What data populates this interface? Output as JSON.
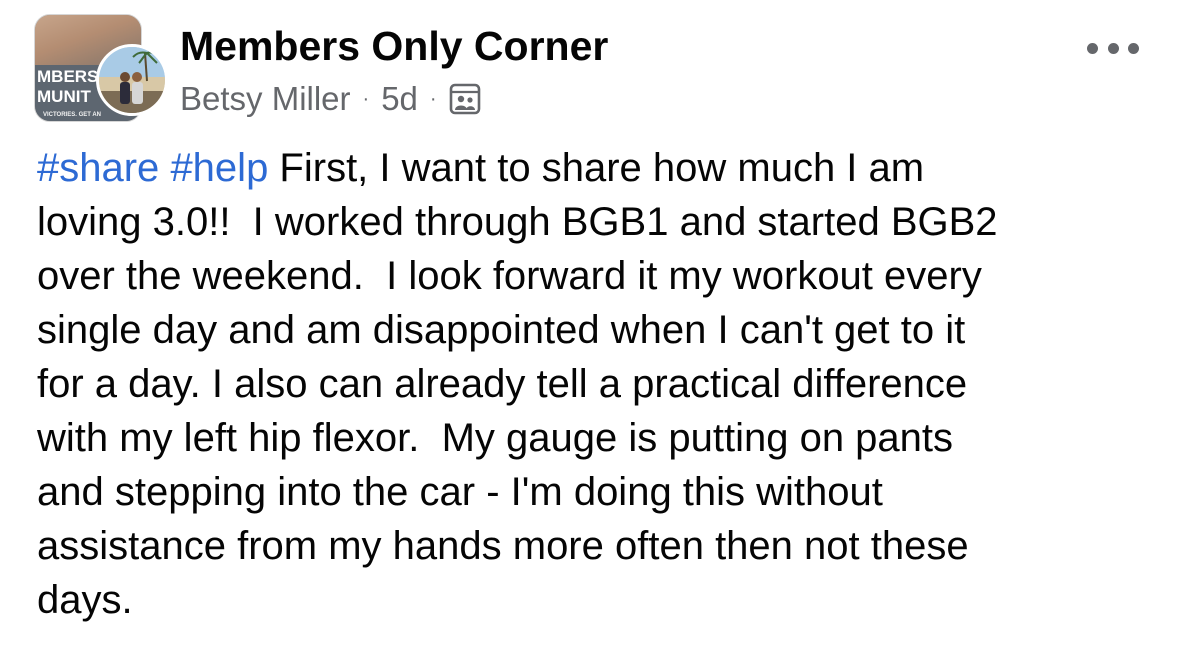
{
  "post": {
    "group_name": "Members Only Corner",
    "group_avatar_text": [
      "MBERS",
      "MUNIT"
    ],
    "group_avatar_small_text": "VICTORIES. GET AN",
    "author": "Betsy Miller",
    "time_ago": "5d",
    "separator": "·",
    "audience_icon": "group-members-icon",
    "more_icon": "more-options-icon",
    "hashtags": [
      "#share",
      "#help"
    ],
    "body_lines": [
      " First, I want to share how much I am",
      "loving 3.0!!  I worked through BGB1 and started BGB2",
      "over the weekend.  I look forward it my workout every",
      "single day and am disappointed when I can't get to it",
      "for a day. I also can already tell a practical difference",
      "with my left hip flexor.  My gauge is putting on pants",
      "and stepping into the car - I'm doing this without",
      "assistance from my hands more often then not these",
      "days."
    ]
  },
  "colors": {
    "text": "#050505",
    "secondary_text": "#65676b",
    "hashtag": "#2d6ad4",
    "background": "#ffffff"
  }
}
